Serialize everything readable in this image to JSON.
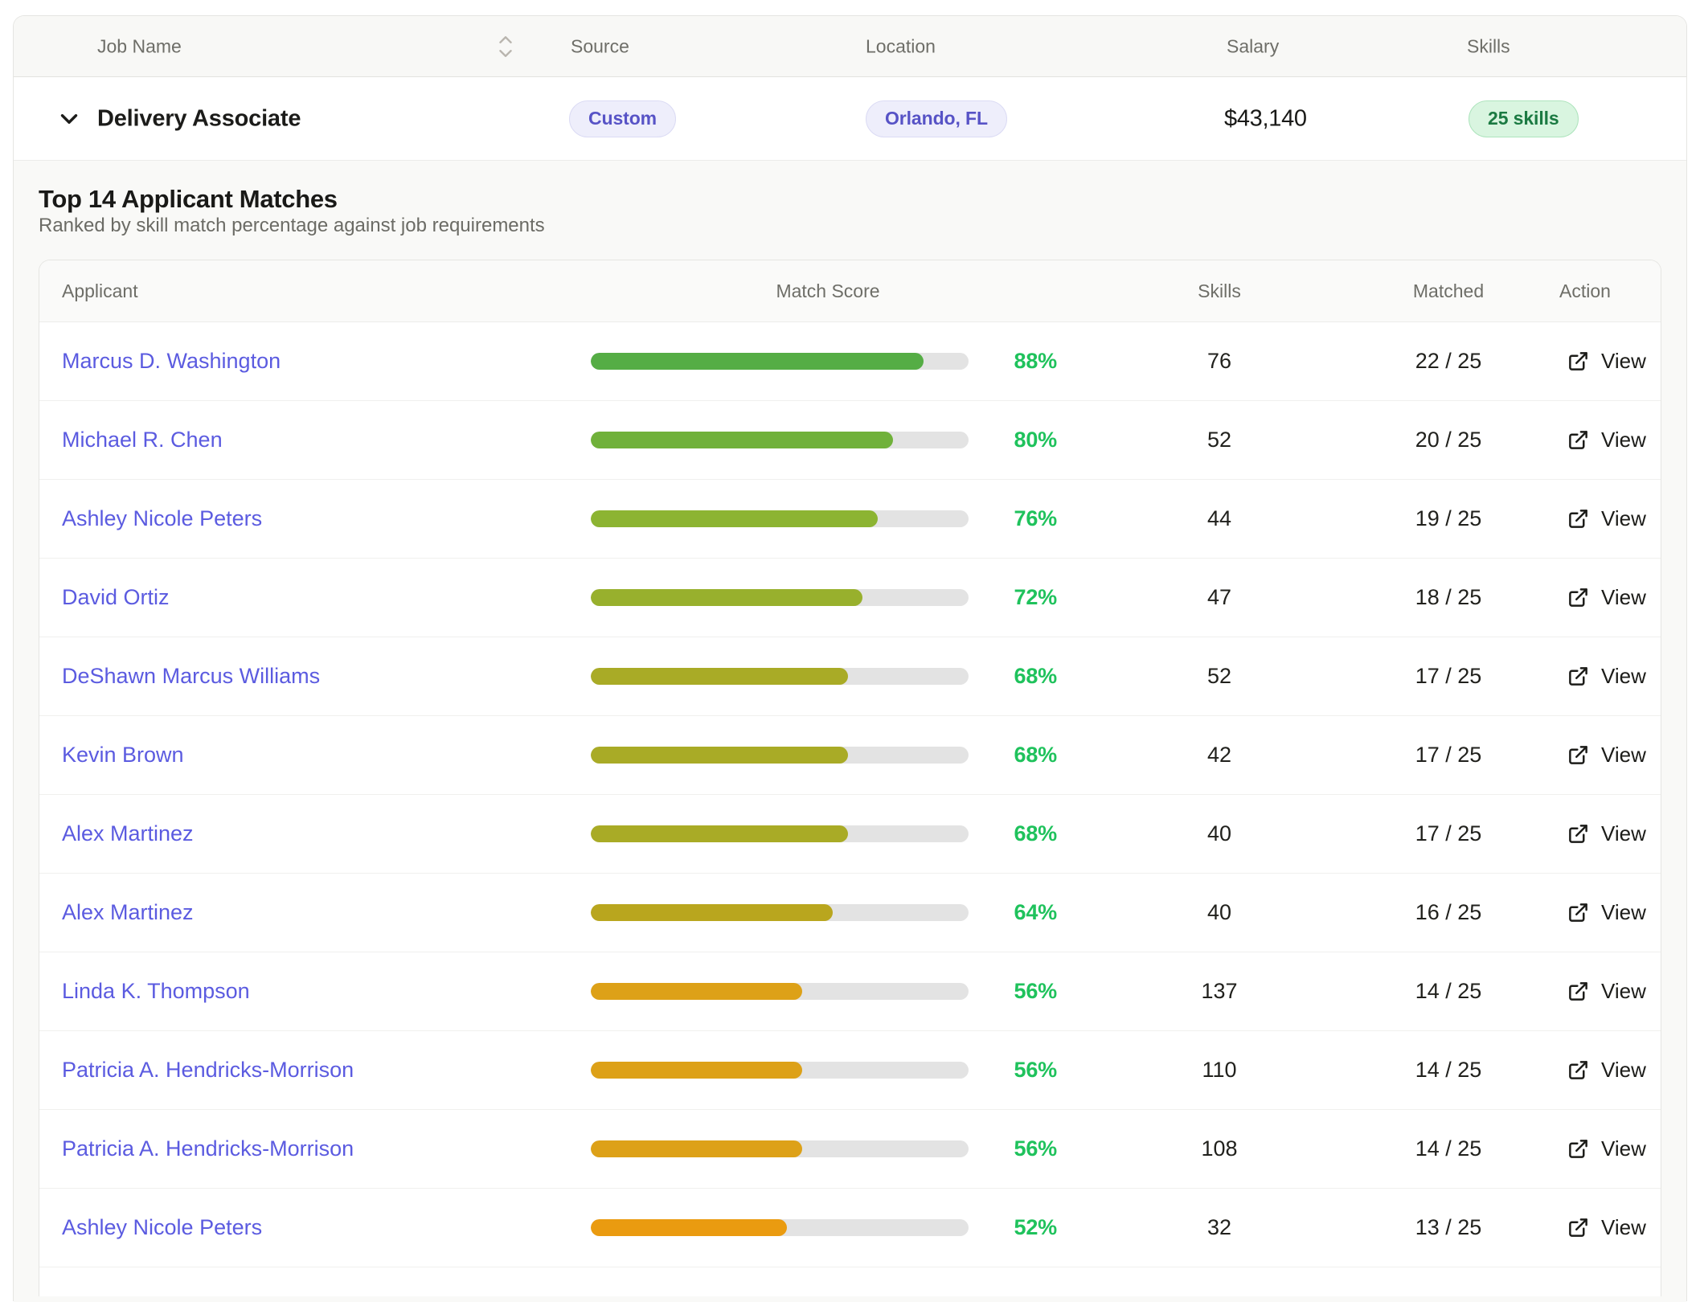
{
  "job_table": {
    "columns": {
      "job_name": "Job Name",
      "source": "Source",
      "location": "Location",
      "salary": "Salary",
      "skills": "Skills"
    },
    "row": {
      "name": "Delivery Associate",
      "source_badge": "Custom",
      "location_badge": "Orlando, FL",
      "salary": "$43,140",
      "skills_badge": "25 skills",
      "expanded": true
    }
  },
  "matches": {
    "title": "Top 14 Applicant Matches",
    "subtitle": "Ranked by skill match percentage against job requirements",
    "columns": {
      "applicant": "Applicant",
      "match_score": "Match Score",
      "skills": "Skills",
      "matched": "Matched",
      "action": "Action"
    },
    "view_label": "View",
    "rows": [
      {
        "name": "Marcus D. Washington",
        "pct": 88,
        "pct_label": "88%",
        "skills": "76",
        "matched": "22 / 25",
        "bar_color": "#55ad45"
      },
      {
        "name": "Michael R. Chen",
        "pct": 80,
        "pct_label": "80%",
        "skills": "52",
        "matched": "20 / 25",
        "bar_color": "#70b13a"
      },
      {
        "name": "Ashley Nicole Peters",
        "pct": 76,
        "pct_label": "76%",
        "skills": "44",
        "matched": "19 / 25",
        "bar_color": "#8cb432"
      },
      {
        "name": "David Ortiz",
        "pct": 72,
        "pct_label": "72%",
        "skills": "47",
        "matched": "18 / 25",
        "bar_color": "#98b02d"
      },
      {
        "name": "DeShawn Marcus Williams",
        "pct": 68,
        "pct_label": "68%",
        "skills": "52",
        "matched": "17 / 25",
        "bar_color": "#a9ab26"
      },
      {
        "name": "Kevin Brown",
        "pct": 68,
        "pct_label": "68%",
        "skills": "42",
        "matched": "17 / 25",
        "bar_color": "#a9ab26"
      },
      {
        "name": "Alex Martinez",
        "pct": 68,
        "pct_label": "68%",
        "skills": "40",
        "matched": "17 / 25",
        "bar_color": "#a9ab26"
      },
      {
        "name": "Alex Martinez",
        "pct": 64,
        "pct_label": "64%",
        "skills": "40",
        "matched": "16 / 25",
        "bar_color": "#b9a61e"
      },
      {
        "name": "Linda K. Thompson",
        "pct": 56,
        "pct_label": "56%",
        "skills": "137",
        "matched": "14 / 25",
        "bar_color": "#dda118"
      },
      {
        "name": "Patricia A. Hendricks-Morrison",
        "pct": 56,
        "pct_label": "56%",
        "skills": "110",
        "matched": "14 / 25",
        "bar_color": "#dda118"
      },
      {
        "name": "Patricia A. Hendricks-Morrison",
        "pct": 56,
        "pct_label": "56%",
        "skills": "108",
        "matched": "14 / 25",
        "bar_color": "#dda118"
      },
      {
        "name": "Ashley Nicole Peters",
        "pct": 52,
        "pct_label": "52%",
        "skills": "32",
        "matched": "13 / 25",
        "bar_color": "#ea9b10"
      }
    ]
  },
  "icons": {
    "sort": "chevron-up-down",
    "expand": "chevron-down",
    "view": "external-link"
  },
  "colors": {
    "link": "#5b5be0",
    "percent_green": "#1fc25c",
    "badge_purple_bg": "#eeeefb",
    "badge_purple_text": "#5753c6",
    "badge_green_bg": "#d9f5e0",
    "badge_green_text": "#1b7a42",
    "bar_track": "#e3e3e3",
    "header_band": "#f8f8f6"
  }
}
